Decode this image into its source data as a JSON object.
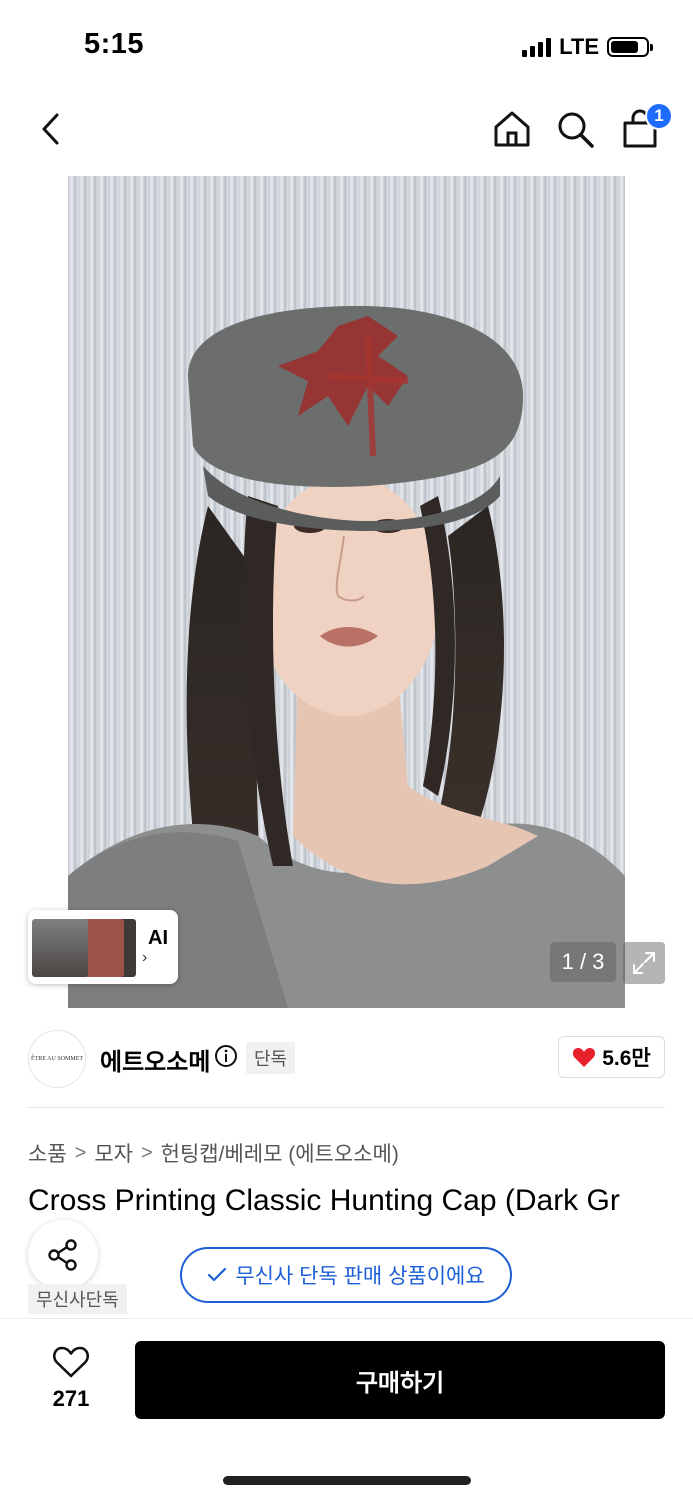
{
  "status_bar": {
    "time": "5:15",
    "network": "LTE"
  },
  "nav": {
    "cart_count": "1"
  },
  "gallery": {
    "counter": "1 / 3",
    "ai_label": "AI",
    "ai_chevron": "›"
  },
  "brand": {
    "name": "에트오소메",
    "logo_text": "ÊTRE AU SOMMET",
    "exclusive_tag": "단독",
    "likes": "5.6만"
  },
  "breadcrumb": {
    "items": [
      "소품",
      "모자",
      "헌팅캡/베레모 (에트오소메)"
    ],
    "separator": ">"
  },
  "product": {
    "title": "Cross Printing Classic Hunting Cap (Dark Gr",
    "exclusive_pill": "무신사 단독 판매 상품이에요",
    "musinsa_tag": "무신사단독"
  },
  "bottom": {
    "wish_count": "271",
    "buy_label": "구매하기"
  },
  "colors": {
    "accent": "#1d5fd6",
    "badge": "#1d6bff",
    "heart": "#e8202a"
  }
}
